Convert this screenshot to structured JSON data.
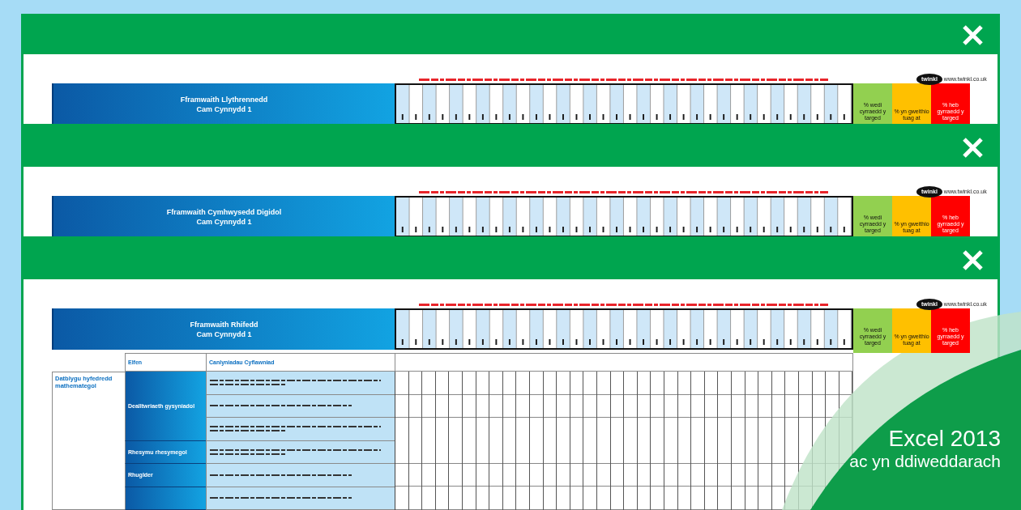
{
  "windows": [
    {
      "header": {
        "title": "Fframwaith Llythrennedd",
        "subtitle": "Cam Cynnydd 1"
      },
      "logo": {
        "text": "twinkl",
        "url": "www.twinkl.co.uk"
      },
      "legend": [
        {
          "label": "% wedi cyrraedd y targed",
          "color": "#92d050"
        },
        {
          "label": "% yn gweithio tuag at",
          "color": "#ffc000"
        },
        {
          "label": "% heb gyrraedd y targed",
          "color": "#ff0000"
        }
      ]
    },
    {
      "header": {
        "title": "Fframwaith Cymhwysedd Digidol",
        "subtitle": "Cam Cynnydd 1"
      },
      "logo": {
        "text": "twinkl",
        "url": "www.twinkl.co.uk"
      },
      "legend": [
        {
          "label": "% wedi cyrraedd y targed",
          "color": "#92d050"
        },
        {
          "label": "% yn gweithio tuag at",
          "color": "#ffc000"
        },
        {
          "label": "% heb gyrraedd y targed",
          "color": "#ff0000"
        }
      ]
    },
    {
      "header": {
        "title": "Fframwaith Rhifedd",
        "subtitle": "Cam Cynnydd 1"
      },
      "logo": {
        "text": "twinkl",
        "url": "www.twinkl.co.uk"
      },
      "legend": [
        {
          "label": "% wedi cyrraedd y targed",
          "color": "#92d050"
        },
        {
          "label": "% yn gweithio tuag at",
          "color": "#ffc000"
        },
        {
          "label": "% heb gyrraedd y targed",
          "color": "#ff0000"
        }
      ],
      "table": {
        "columns": [
          "Elfen",
          "Canlyniadau Cyflawniad"
        ],
        "strand": "Datblygu hyfedredd mathemategol",
        "elements": [
          {
            "name": "Dealltwriaeth gysyniadol",
            "outcomes": [
              {
                "kind": "long"
              },
              {
                "kind": "short"
              },
              {
                "kind": "long"
              }
            ]
          },
          {
            "name": "Rhesymu rhesymegol",
            "outcomes": [
              {
                "kind": "long"
              }
            ]
          },
          {
            "name": "Rhuglder",
            "outcomes": [
              {
                "kind": "short"
              }
            ]
          },
          {
            "outcomes": [
              {
                "kind": "short"
              }
            ]
          }
        ]
      }
    }
  ],
  "badge": {
    "title": "Excel 2013",
    "subtitle": "ac yn ddiweddarach"
  }
}
